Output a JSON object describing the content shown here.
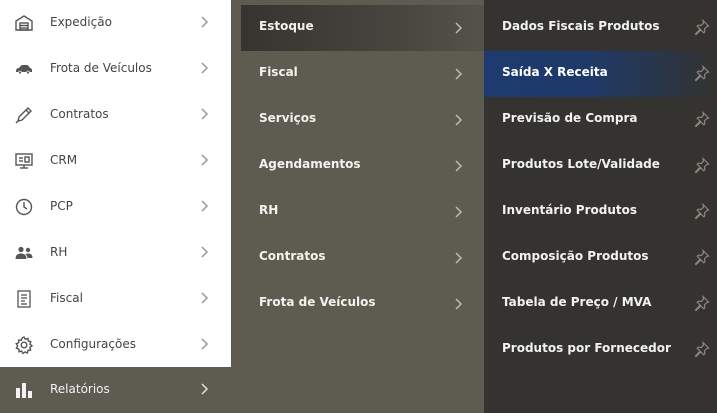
{
  "main_menu": {
    "items": [
      {
        "label": "Expedição",
        "icon": "warehouse-icon"
      },
      {
        "label": "Frota de Veículos",
        "icon": "car-icon"
      },
      {
        "label": "Contratos",
        "icon": "pen-icon"
      },
      {
        "label": "CRM",
        "icon": "monitor-icon"
      },
      {
        "label": "PCP",
        "icon": "clock-icon"
      },
      {
        "label": "RH",
        "icon": "users-icon"
      },
      {
        "label": "Fiscal",
        "icon": "document-icon"
      },
      {
        "label": "Configurações",
        "icon": "gear-icon"
      },
      {
        "label": "Relatórios",
        "icon": "bar-chart-icon",
        "active": true
      }
    ]
  },
  "submenu": {
    "items": [
      {
        "label": "Estoque",
        "active": true
      },
      {
        "label": "Fiscal"
      },
      {
        "label": "Serviços"
      },
      {
        "label": "Agendamentos"
      },
      {
        "label": "RH"
      },
      {
        "label": "Contratos"
      },
      {
        "label": "Frota de Veículos"
      }
    ]
  },
  "reports": {
    "items": [
      {
        "label": "Dados Fiscais Produtos"
      },
      {
        "label": "Saída X Receita",
        "active": true
      },
      {
        "label": "Previsão de Compra"
      },
      {
        "label": "Produtos Lote/Validade"
      },
      {
        "label": "Inventário Produtos"
      },
      {
        "label": "Composição Produtos"
      },
      {
        "label": "Tabela de Preço / MVA"
      },
      {
        "label": "Produtos por Fornecedor"
      }
    ]
  },
  "colors": {
    "active_main_bg": "#5e5b51",
    "submenu_bg": "#5e5b51",
    "reports_bg": "#34332f",
    "active_report_highlight": "#1d3b70"
  }
}
